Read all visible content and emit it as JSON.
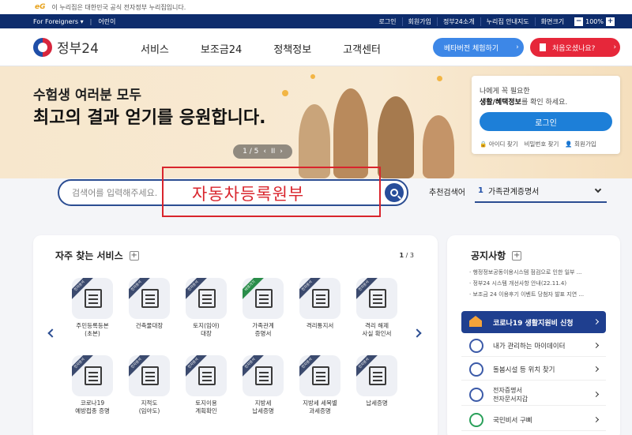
{
  "gov_banner": {
    "logo": "eG",
    "text": "이 누리집은 대한민국 공식 전자정부 누리집입니다."
  },
  "topbar": {
    "left": [
      "For Foreigners ▾",
      "어린이"
    ],
    "right": [
      "로그인",
      "회원가입",
      "정부24소개",
      "누리집 안내지도",
      "화면크기"
    ],
    "zoom_minus": "−",
    "zoom_value": "100%",
    "zoom_plus": "+"
  },
  "logo": {
    "text": "정부24"
  },
  "menu": [
    "서비스",
    "보조금24",
    "정책정보",
    "고객센터"
  ],
  "beta_button": {
    "label": "베타버전 체험하기",
    "arrow": "›"
  },
  "first_visit_button": {
    "label": "처음오셨나요?",
    "arrow": "›"
  },
  "hero": {
    "line1": "수험생 여러분 모두",
    "line2": "최고의 결과 얻기를 응원합니다.",
    "pager": {
      "current": "1 / 5",
      "prev": "‹",
      "pause": "II",
      "next": "›"
    }
  },
  "login_card": {
    "line1": "나에게 꼭 필요한",
    "line2_bold": "생활/혜택정보",
    "line2_rest": "를 확인 하세요.",
    "login_label": "로그인",
    "links": [
      "아이디 찾기",
      "비밀번호 찾기",
      "회원가입"
    ]
  },
  "search": {
    "placeholder": "검색어를 입력해주세요.",
    "value": ""
  },
  "annotation": {
    "text": "자동차등록원부",
    "color": "#d9252d"
  },
  "recommended": {
    "label": "추천검색어",
    "rank": "1",
    "term": "가족관계증명서"
  },
  "services": {
    "title": "자주 찾는 서비스",
    "plus": "+",
    "page_current": "1",
    "page_total": " / 3",
    "tiles": [
      {
        "ribbon": "전자문서",
        "label": "주민등록등본\n(초본)"
      },
      {
        "ribbon": "전자문서",
        "label": "건축물대장"
      },
      {
        "ribbon": "전자문서",
        "label": "토지(임야)\n대장"
      },
      {
        "ribbon": "바로가기",
        "label": "가족관계\n증명서"
      },
      {
        "ribbon": "전자문서",
        "label": "격리통지서"
      },
      {
        "ribbon": "전자문서",
        "label": "격리 해제\n사실 확인서"
      },
      {
        "ribbon": "전자문서",
        "label": "코로나19\n예방접종 증명"
      },
      {
        "ribbon": "전자문서",
        "label": "지적도\n(임야도)"
      },
      {
        "ribbon": "전자문서",
        "label": "토지이용\n계획확인"
      },
      {
        "ribbon": "전자문서",
        "label": "지방세\n납세증명"
      },
      {
        "ribbon": "전자문서",
        "label": "지방세 세목별\n과세증명"
      },
      {
        "ribbon": "전자문서",
        "label": "납세증명"
      }
    ]
  },
  "notice": {
    "title": "공지사항",
    "plus": "+",
    "items": [
      "행정정보공동이용시스템 점검으로 인한 일부 ...",
      "정부24 시스템 개선사항 안내(22.11.4)",
      "보조금 24 이용후기 이벤트 당첨자 발표 지연 ..."
    ],
    "covid_button": "코로나19 생활지원비 신청",
    "links": [
      {
        "label": "내가 관리하는 마이데이터"
      },
      {
        "label": "돌봄시설 등 위치 찾기"
      },
      {
        "label": "전자증명서\n전자문서지갑"
      },
      {
        "label": "국민비서 구삐"
      }
    ]
  },
  "colors": {
    "navy": "#0d2c6c",
    "accent_blue": "#3d87e7",
    "accent_red": "#e6273a",
    "hero_bg": "#f8ead3"
  }
}
